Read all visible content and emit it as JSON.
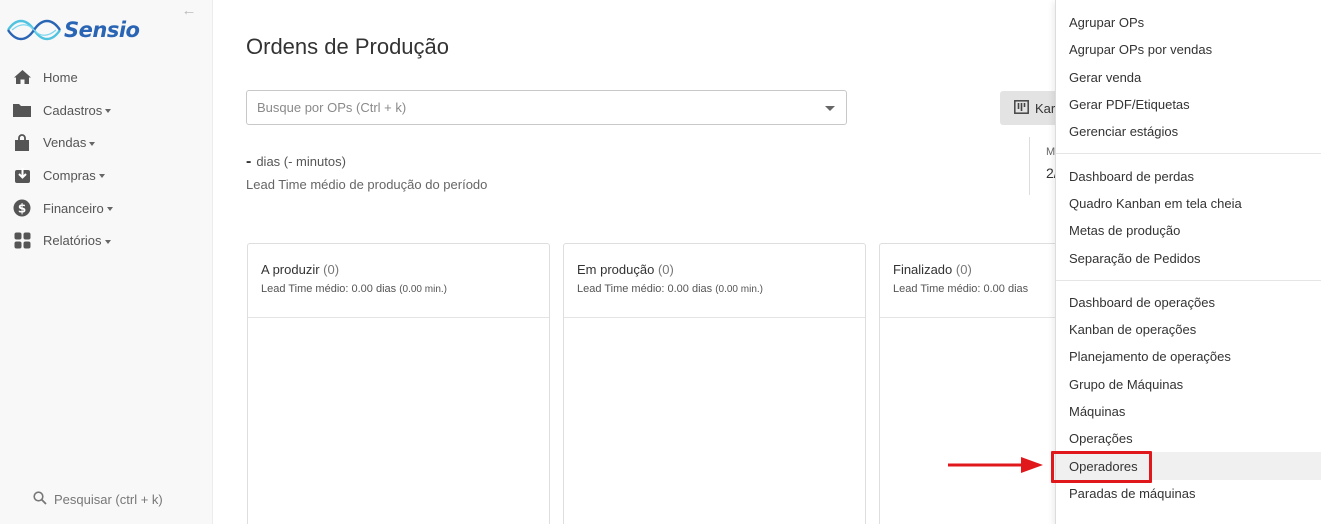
{
  "brand": {
    "name": "Sensio",
    "color": "#2a64b4"
  },
  "sidebar": {
    "items": [
      {
        "label": "Home",
        "icon": "home-icon",
        "has_caret": false
      },
      {
        "label": "Cadastros",
        "icon": "folder-icon",
        "has_caret": true
      },
      {
        "label": "Vendas",
        "icon": "shopping-bag-icon",
        "has_caret": true
      },
      {
        "label": "Compras",
        "icon": "inbox-download-icon",
        "has_caret": true
      },
      {
        "label": "Financeiro",
        "icon": "dollar-icon",
        "has_caret": true
      },
      {
        "label": "Relatórios",
        "icon": "grid-icon",
        "has_caret": true
      }
    ],
    "search_label": "Pesquisar (ctrl + k)"
  },
  "main": {
    "title": "Ordens de Produção",
    "search_placeholder": "Busque por OPs (Ctrl + k)",
    "kanban_button_label": "Kar",
    "date_box": {
      "label": "M",
      "value": "2/"
    },
    "lead_time": {
      "dash": "-",
      "days_text": "dias (- minutos)",
      "caption": "Lead Time médio de produção do período"
    },
    "columns": [
      {
        "title": "A produzir",
        "count": "(0)",
        "sub": "Lead Time médio: 0.00 dias",
        "sub_small": "(0.00 min.)"
      },
      {
        "title": "Em produção",
        "count": "(0)",
        "sub": "Lead Time médio: 0.00 dias",
        "sub_small": "(0.00 min.)"
      },
      {
        "title": "Finalizado",
        "count": "(0)",
        "sub": "Lead Time médio: 0.00 dias",
        "sub_small": ""
      }
    ]
  },
  "dropdown": {
    "groups": [
      [
        "Agrupar OPs",
        "Agrupar OPs por vendas",
        "Gerar venda",
        "Gerar PDF/Etiquetas",
        "Gerenciar estágios"
      ],
      [
        "Dashboard de perdas",
        "Quadro Kanban em tela cheia",
        "Metas de produção",
        "Separação de Pedidos"
      ],
      [
        "Dashboard de operações",
        "Kanban de operações",
        "Planejamento de operações",
        "Grupo de Máquinas",
        "Máquinas",
        "Operações",
        "Operadores",
        "Paradas de máquinas"
      ]
    ],
    "highlighted_item": "Operadores",
    "highlight_color": "#e0181b"
  }
}
